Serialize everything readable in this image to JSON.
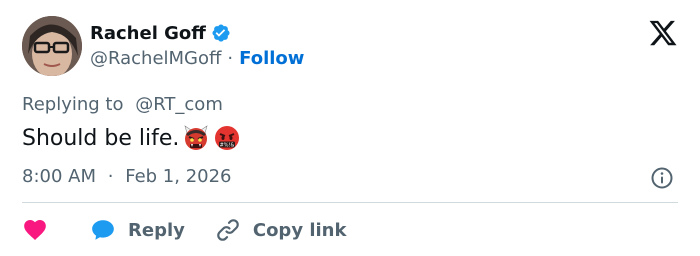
{
  "author": {
    "name": "Rachel Goff",
    "handle": "@RachelMGoff",
    "separator": "·",
    "follow_label": "Follow",
    "verified_color": "#1d9bf0"
  },
  "tweet": {
    "replying_prefix": "Replying to",
    "replying_to": "@RT_com",
    "text": "Should be life.",
    "emojis": [
      "ogre-emoji",
      "face-with-symbols-on-mouth-emoji"
    ],
    "time": "8:00 AM",
    "date_separator": "·",
    "date": "Feb 1, 2026"
  },
  "actions": {
    "like_icon": "heart-icon",
    "reply_label": "Reply",
    "copy_link_label": "Copy link"
  },
  "colors": {
    "text": "#0f1419",
    "muted": "#536471",
    "link": "#006fd6",
    "heart": "#f91880",
    "reply_bubble": "#1d9bf0",
    "divider": "#cfd9de"
  }
}
